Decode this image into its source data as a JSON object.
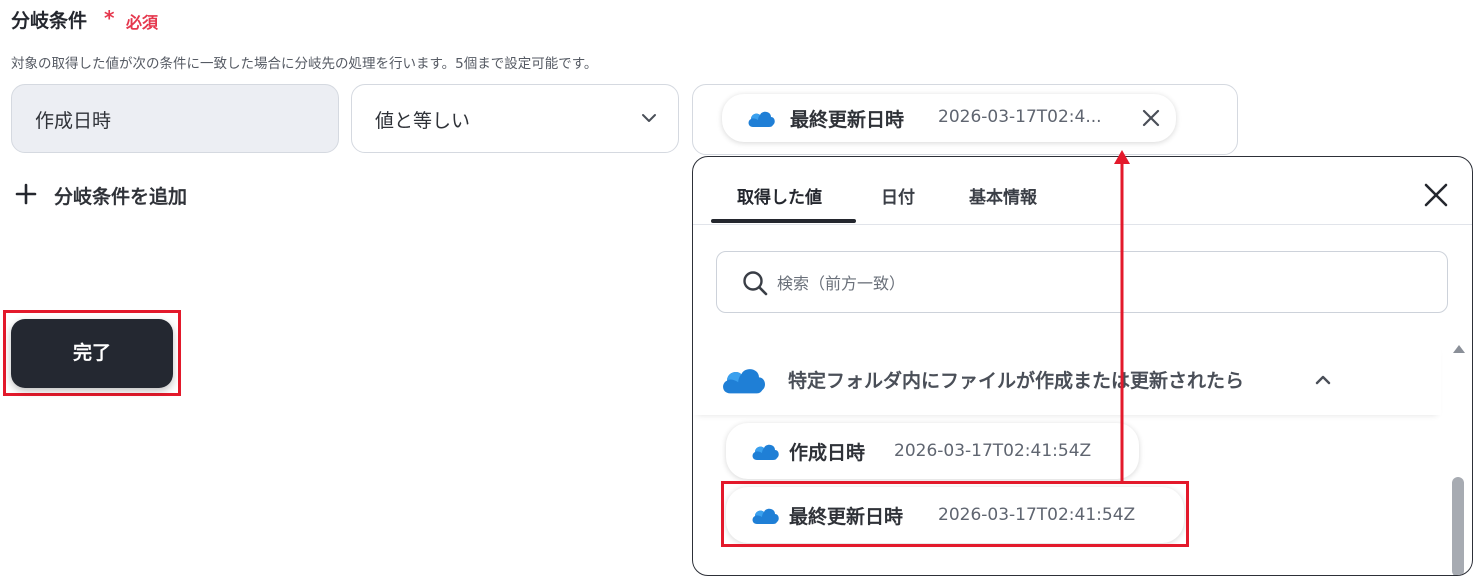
{
  "header": {
    "title": "分岐条件",
    "required_star": "*",
    "required_label": "必須",
    "description": "対象の取得した値が次の条件に一致した場合に分岐先の処理を行います。5個まで設定可能です。"
  },
  "condition": {
    "field": "作成日時",
    "operator": "値と等しい",
    "value_chip": {
      "name": "最終更新日時",
      "value": "2026-03-17T02:4..."
    }
  },
  "add_condition_label": "分岐条件を追加",
  "done_label": "完了",
  "panel": {
    "tabs": [
      {
        "label": "取得した値",
        "active": true
      },
      {
        "label": "日付",
        "active": false
      },
      {
        "label": "基本情報",
        "active": false
      }
    ],
    "search_placeholder": "検索（前方一致）",
    "section_title": "特定フォルダ内にファイルが作成または更新されたら",
    "items": [
      {
        "name": "作成日時",
        "value": "2026-03-17T02:41:54Z"
      },
      {
        "name": "最終更新日時",
        "value": "2026-03-17T02:41:54Z"
      }
    ]
  },
  "colors": {
    "required": "#e5374d",
    "highlight": "#e3192b",
    "done_button": "#242831",
    "cloud": "#1f7fd6"
  },
  "icons": [
    "chevron-down-icon",
    "onedrive-cloud-icon",
    "close-icon",
    "plus-icon",
    "search-icon",
    "chevron-up-icon"
  ]
}
